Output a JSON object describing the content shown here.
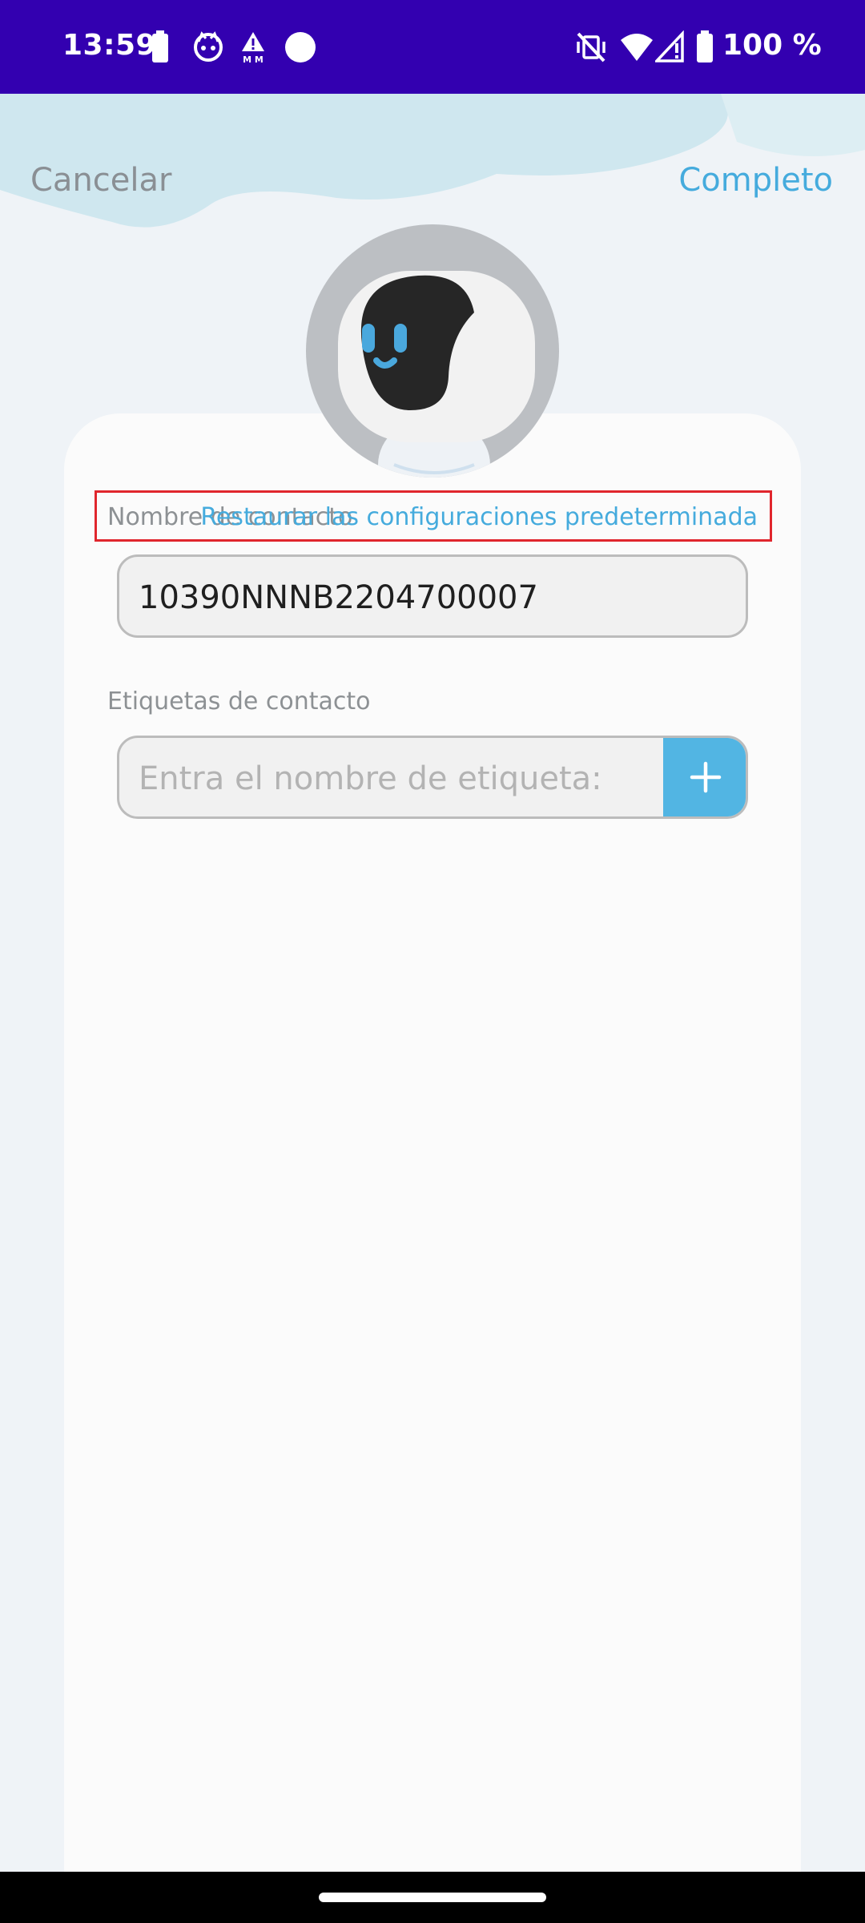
{
  "status_bar": {
    "time": "13:59",
    "battery_text": "100 %",
    "icons": [
      "battery-icon",
      "cat-notification-icon",
      "mm-warning-icon",
      "circle-icon",
      "vibrate-off-icon",
      "wifi-icon",
      "signal-icon",
      "battery-full-icon"
    ]
  },
  "header": {
    "cancel_label": "Cancelar",
    "complete_label": "Completo"
  },
  "form": {
    "name_label": "Nombre de contacto",
    "restore_label": "Restaurar las configuraciones predeterminada",
    "name_value": "10390NNNB2204700007",
    "tags_label": "Etiquetas de contacto",
    "tag_placeholder": "Entra el nombre de etiqueta:",
    "add_icon": "plus-icon"
  },
  "colors": {
    "status_bar": "#3300b0",
    "accent": "#45abdd",
    "add_button": "#52b5e3",
    "highlight_border": "#e0262d"
  }
}
